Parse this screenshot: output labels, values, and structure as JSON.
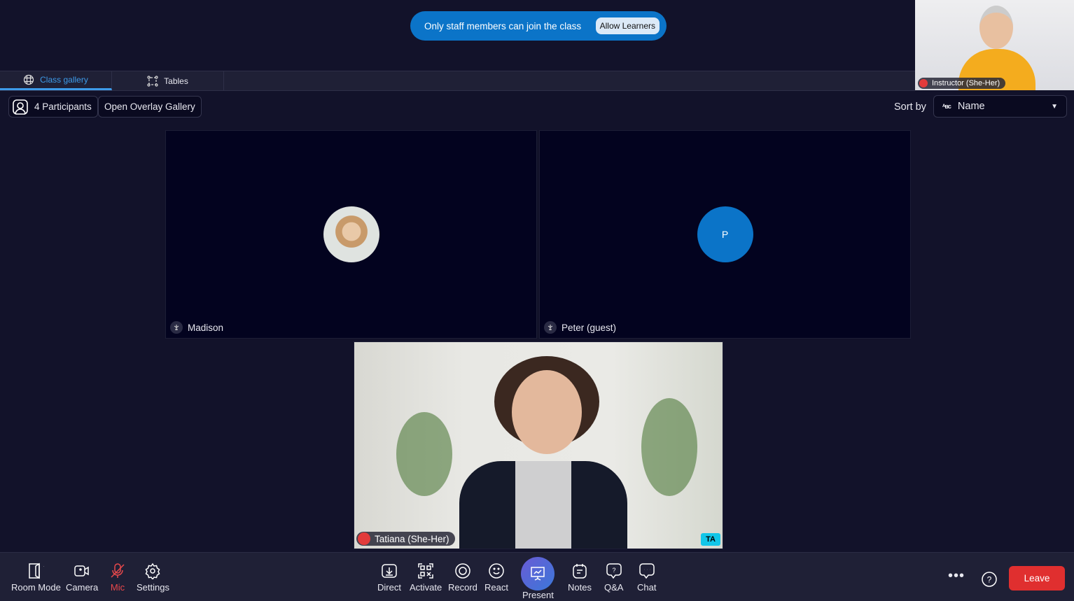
{
  "banner": {
    "text": "Only staff members can join the class",
    "button": "Allow Learners",
    "color": "#0b74c8"
  },
  "self_view": {
    "name": "Instructor (She-Her)",
    "mic": "muted"
  },
  "tabs": [
    {
      "label": "Class gallery",
      "icon": "globe-grid-icon",
      "active": true
    },
    {
      "label": "Tables",
      "icon": "tables-icon",
      "active": false
    }
  ],
  "controls": {
    "participants": "4 Participants",
    "overlay": "Open Overlay Gallery",
    "sort_label": "Sort by",
    "sort_value": "Name"
  },
  "tiles": [
    {
      "name": "Madison",
      "avatar": "photo"
    },
    {
      "name": "Peter (guest)",
      "avatar_initial": "P",
      "avatar_color": "#0b74c8"
    },
    {
      "name": "Tatiana (She-Her)",
      "mic": "muted",
      "role_badge": "TA",
      "badge_color": "#12c6e8"
    }
  ],
  "toolbar": {
    "left": [
      {
        "label": "Room Mode",
        "icon": "door-icon"
      },
      {
        "label": "Camera",
        "icon": "camera-icon"
      },
      {
        "label": "Mic",
        "icon": "mic-off-icon",
        "color": "#e8484b"
      },
      {
        "label": "Settings",
        "icon": "gear-icon"
      }
    ],
    "center": [
      {
        "label": "Direct",
        "icon": "download-icon"
      },
      {
        "label": "Activate",
        "icon": "qr-icon"
      },
      {
        "label": "Record",
        "icon": "record-icon"
      },
      {
        "label": "React",
        "icon": "smile-icon"
      },
      {
        "label": "Present",
        "icon": "presentation-icon"
      },
      {
        "label": "Notes",
        "icon": "notes-icon"
      },
      {
        "label": "Q&A",
        "icon": "question-bubble-icon"
      },
      {
        "label": "Chat",
        "icon": "chat-icon"
      }
    ],
    "leave": "Leave"
  }
}
